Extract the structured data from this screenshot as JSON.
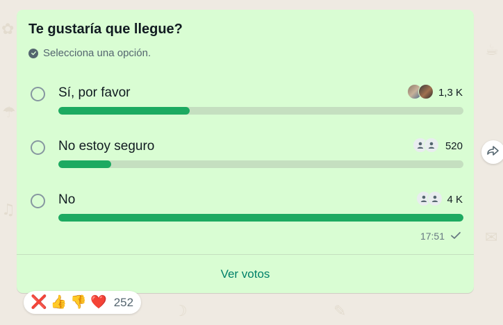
{
  "poll": {
    "question": "Te gustaría que llegue?",
    "hint": "Selecciona una opción.",
    "options": [
      {
        "label": "Sí, por favor",
        "count": "1,3 K",
        "fraction": 0.325
      },
      {
        "label": "No estoy seguro",
        "count": "520",
        "fraction": 0.13
      },
      {
        "label": "No",
        "count": "4 K",
        "fraction": 1.0
      }
    ],
    "time": "17:51",
    "see_votes": "Ver votos"
  },
  "reactions": {
    "emojis": [
      "❌",
      "👍",
      "👎",
      "❤️"
    ],
    "count": "252"
  },
  "icons": {
    "hint": "check-circle-icon",
    "status": "single-check-icon",
    "forward": "forward-icon"
  },
  "colors": {
    "bubble": "#d9fdd3",
    "bar_fill": "#1daa61",
    "bar_track": "#c5dfc0",
    "link": "#008069",
    "background": "#efeae2"
  }
}
